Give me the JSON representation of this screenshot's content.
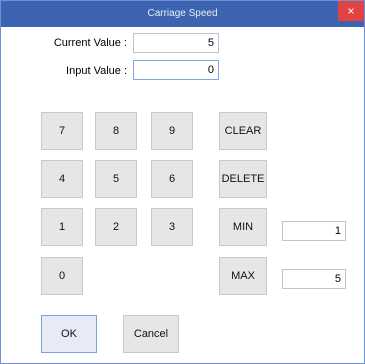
{
  "window": {
    "title": "Carriage Speed",
    "close_glyph": "×"
  },
  "current_value": {
    "label": "Current Value :",
    "value": "5"
  },
  "input_value": {
    "label": "Input Value :",
    "value": "0"
  },
  "keypad": {
    "k7": "7",
    "k8": "8",
    "k9": "9",
    "k4": "4",
    "k5": "5",
    "k6": "6",
    "k1": "1",
    "k2": "2",
    "k3": "3",
    "k0": "0"
  },
  "actions": {
    "clear": "CLEAR",
    "delete": "DELETE",
    "min": "MIN",
    "max": "MAX"
  },
  "limits": {
    "min_value": "1",
    "max_value": "5"
  },
  "footer": {
    "ok": "OK",
    "cancel": "Cancel"
  },
  "colors": {
    "titlebar": "#3d64b0",
    "close": "#e04343",
    "button": "#e6e6e6"
  }
}
